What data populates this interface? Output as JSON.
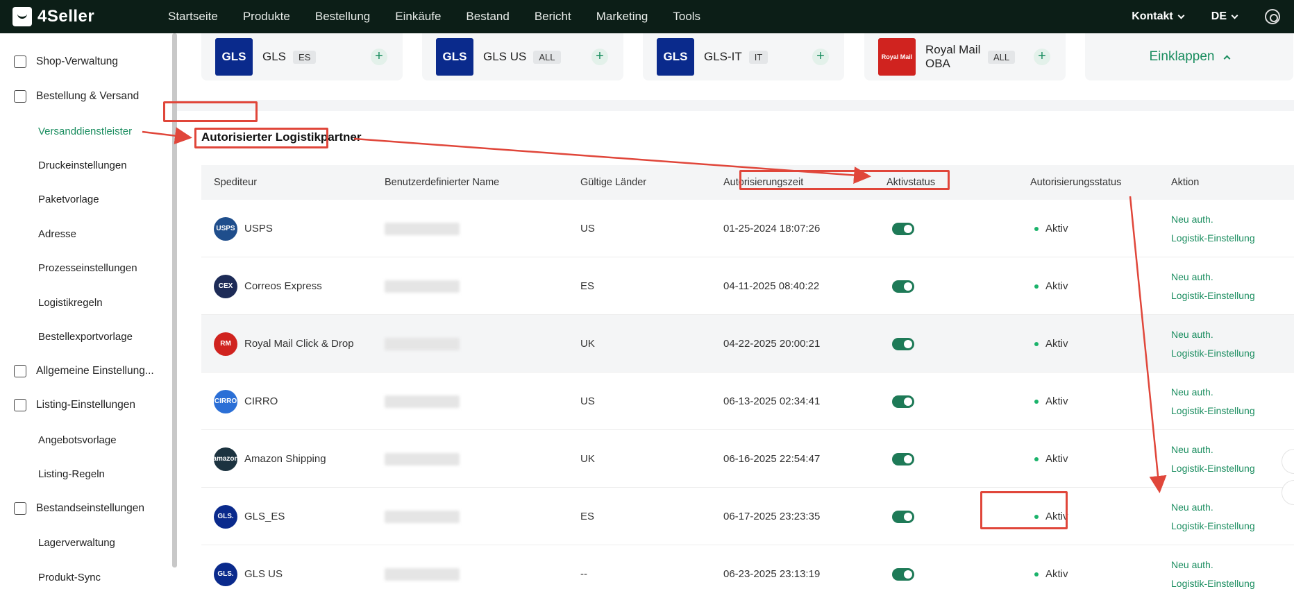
{
  "app": {
    "brand": "4Seller"
  },
  "nav": [
    "Startseite",
    "Produkte",
    "Bestellung",
    "Einkäufe",
    "Bestand",
    "Bericht",
    "Marketing",
    "Tools"
  ],
  "top_right": {
    "contact": "Kontakt",
    "language": "DE"
  },
  "sidebar": {
    "groups": [
      {
        "label": "Shop-Verwaltung",
        "icon": "shop-icon"
      },
      {
        "label": "Bestellung & Versand",
        "icon": "bag-icon"
      },
      {
        "label": "Allgemeine Einstellung...",
        "icon": "printer-icon"
      },
      {
        "label": "Listing-Einstellungen",
        "icon": "upload-icon"
      },
      {
        "label": "Bestandseinstellungen",
        "icon": "warehouse-icon"
      }
    ],
    "items": [
      "Versanddienstleister",
      "Druckeinstellungen",
      "Paketvorlage",
      "Adresse",
      "Prozesseinstellungen",
      "Logistikregeln",
      "Bestellexportvorlage",
      "Angebotsvorlage",
      "Listing-Regeln",
      "Lagerverwaltung",
      "Produkt-Sync"
    ]
  },
  "carrier_cards": [
    {
      "name": "GLS",
      "tag": "ES",
      "logo": "GLS"
    },
    {
      "name": "GLS US",
      "tag": "ALL",
      "logo": "GLS"
    },
    {
      "name": "GLS-IT",
      "tag": "IT",
      "logo": "GLS"
    },
    {
      "name": "Royal Mail OBA",
      "tag": "ALL",
      "logo": "Royal Mail"
    }
  ],
  "collapse_label": "Einklappen",
  "section_title": "Autorisierter Logistikpartner",
  "table": {
    "headers": [
      "Spediteur",
      "Benutzerdefinierter Name",
      "Gültige Länder",
      "Autorisierungszeit",
      "Aktivstatus",
      "Autorisierungsstatus",
      "Aktion"
    ],
    "rows": [
      {
        "carrier": "USPS",
        "country": "US",
        "time": "01-25-2024 18:07:26",
        "status": "Aktiv",
        "logo_color": "#1f4e8c",
        "logo_text": "USPS"
      },
      {
        "carrier": "Correos Express",
        "country": "ES",
        "time": "04-11-2025 08:40:22",
        "status": "Aktiv",
        "logo_color": "#1d2b57",
        "logo_text": "CEX"
      },
      {
        "carrier": "Royal Mail Click & Drop",
        "country": "UK",
        "time": "04-22-2025 20:00:21",
        "status": "Aktiv",
        "logo_color": "#d0231f",
        "logo_text": "RM"
      },
      {
        "carrier": "CIRRO",
        "country": "US",
        "time": "06-13-2025 02:34:41",
        "status": "Aktiv",
        "logo_color": "#2b6fd6",
        "logo_text": "CIRRO"
      },
      {
        "carrier": "Amazon Shipping",
        "country": "UK",
        "time": "06-16-2025 22:54:47",
        "status": "Aktiv",
        "logo_color": "#1c3340",
        "logo_text": "amazon"
      },
      {
        "carrier": "GLS_ES",
        "country": "ES",
        "time": "06-17-2025 23:23:35",
        "status": "Aktiv",
        "logo_color": "#0a2a8c",
        "logo_text": "GLS."
      },
      {
        "carrier": "GLS US",
        "country": "--",
        "time": "06-23-2025 23:13:19",
        "status": "Aktiv",
        "logo_color": "#0a2a8c",
        "logo_text": "GLS."
      }
    ],
    "actions": {
      "reauth": "Neu auth.",
      "settings": "Logistik-Einstellung"
    }
  },
  "colors": {
    "accent": "#1a8d5f",
    "topbar": "#0c1e17",
    "annotation": "#e0463a"
  }
}
